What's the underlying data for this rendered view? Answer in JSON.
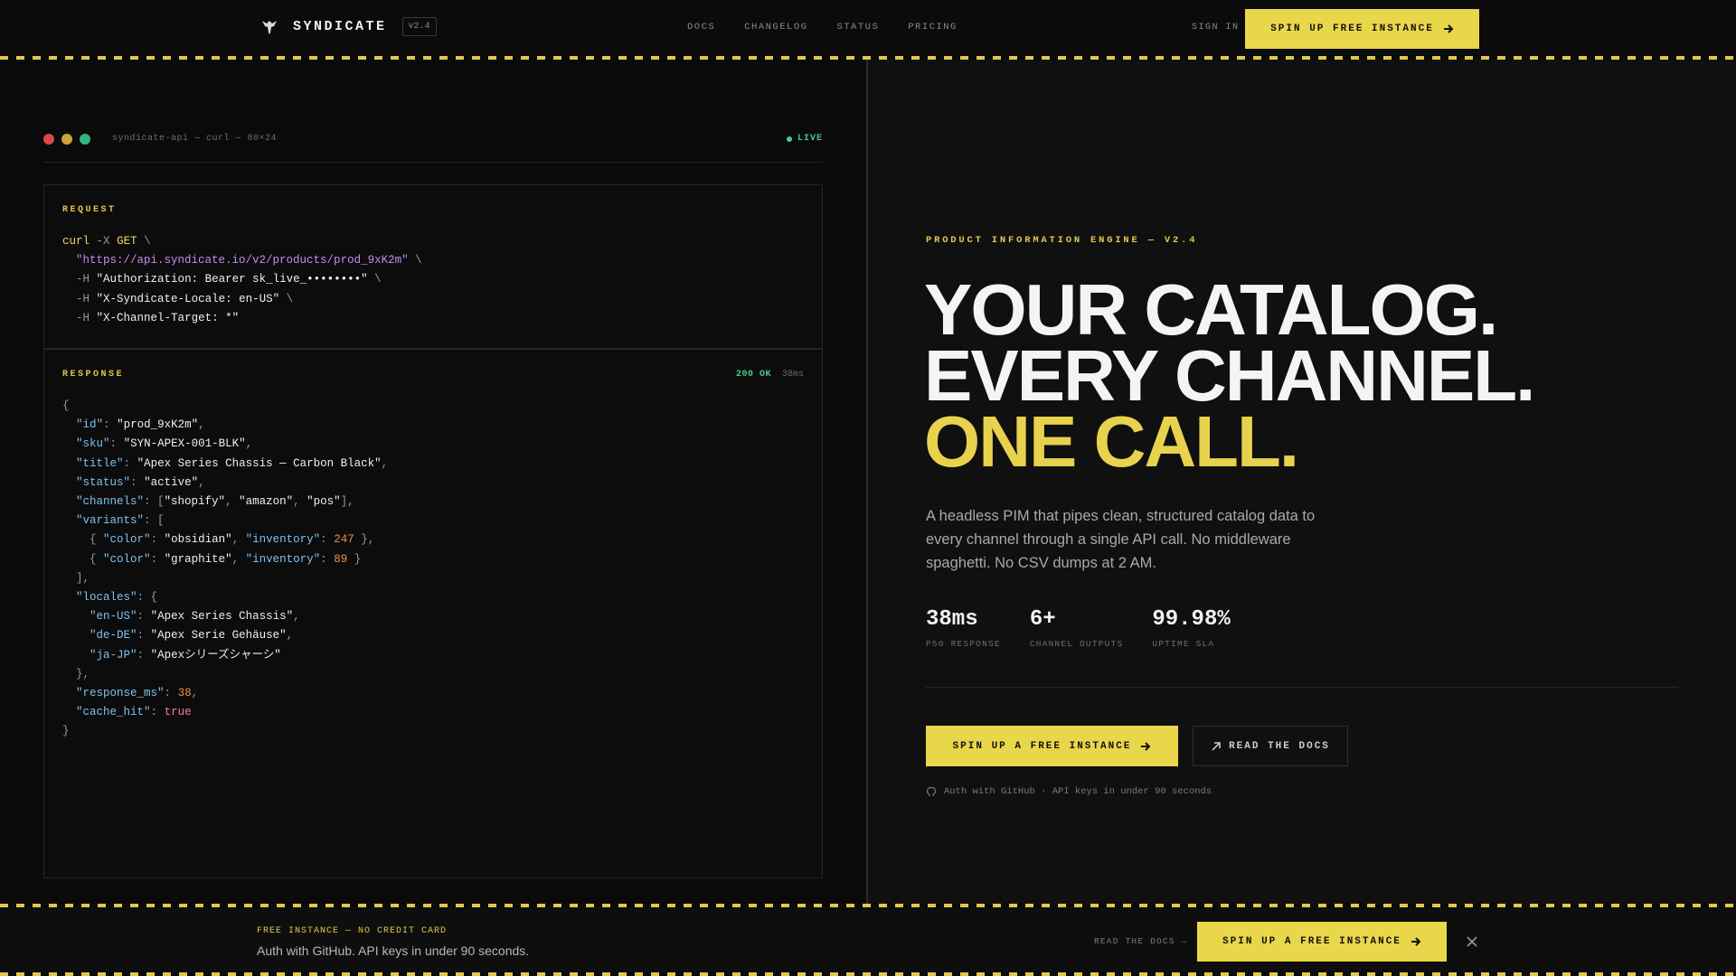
{
  "nav": {
    "brand": "SYNDICATE",
    "version": "v2.4",
    "links": [
      "DOCS",
      "CHANGELOG",
      "STATUS",
      "PRICING"
    ],
    "sign_in": "SIGN IN",
    "cta": "SPIN UP FREE INSTANCE"
  },
  "terminal": {
    "title": "syndicate-api — curl — 80×24",
    "live": "LIVE",
    "request_label": "REQUEST",
    "request_lines": [
      "curl -X GET \\",
      "  \"https://api.syndicate.io/v2/products/prod_9xK2m\" \\",
      "  -H \"Authorization: Bearer sk_live_••••••••\" \\",
      "  -H \"X-Syndicate-Locale: en-US\" \\",
      "  -H \"X-Channel-Target: *\""
    ],
    "response_label": "RESPONSE",
    "status": "200 OK",
    "latency": "38ms",
    "response_lines": [
      "{",
      "  \"id\": \"prod_9xK2m\",",
      "  \"sku\": \"SYN-APEX-001-BLK\",",
      "  \"title\": \"Apex Series Chassis — Carbon Black\",",
      "  \"status\": \"active\",",
      "  \"channels\": [\"shopify\", \"amazon\", \"pos\"],",
      "  \"variants\": [",
      "    { \"color\": \"obsidian\", \"inventory\": 247 },",
      "    { \"color\": \"graphite\", \"inventory\": 89 }",
      "  ],",
      "  \"locales\": {",
      "    \"en-US\": \"Apex Series Chassis\",",
      "    \"de-DE\": \"Apex Serie Gehäuse\",",
      "    \"ja-JP\": \"Apexシリーズシャーシ\"",
      "  },",
      "  \"response_ms\": 38,",
      "  \"cache_hit\": true",
      "}"
    ]
  },
  "hero": {
    "eyebrow": "PRODUCT INFORMATION ENGINE — V2.4",
    "headline_1": "YOUR CATALOG.",
    "headline_2": "EVERY CHANNEL.",
    "headline_3": "ONE CALL.",
    "subcopy": "A headless PIM that pipes clean, structured catalog data to every channel through a single API call. No middleware spaghetti. No CSV dumps at 2 AM.",
    "stats": [
      {
        "value": "38ms",
        "label": "P50 RESPONSE"
      },
      {
        "value": "6+",
        "label": "CHANNEL OUTPUTS"
      },
      {
        "value": "99.98%",
        "label": "UPTIME SLA"
      }
    ],
    "cta_primary": "SPIN UP A FREE INSTANCE",
    "cta_secondary": "READ THE DOCS",
    "auth_note": "Auth with GitHub · API keys in under 90 seconds"
  },
  "bottom_bar": {
    "tag": "FREE INSTANCE — NO CREDIT CARD",
    "text": "Auth with GitHub. API keys in under 90 seconds.",
    "docs_link": "READ THE DOCS →",
    "cta": "SPIN UP A FREE INSTANCE"
  },
  "colors": {
    "accent": "#e8d24d",
    "background": "#0b0b0b",
    "live": "#4ec88d"
  }
}
